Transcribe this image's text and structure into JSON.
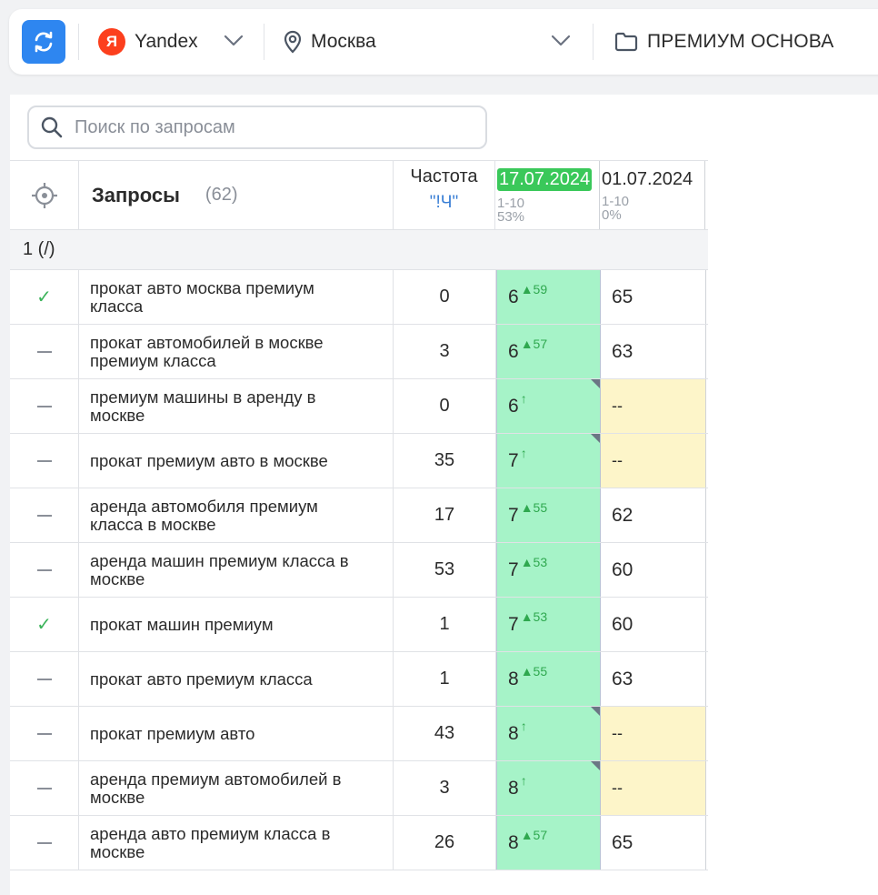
{
  "toolbar": {
    "engine": "Yandex",
    "engine_logo": "Я",
    "region": "Москва",
    "project": "ПРЕМИУМ ОСНОВА"
  },
  "search": {
    "placeholder": "Поиск по запросам",
    "value": ""
  },
  "table": {
    "queries_title": "Запросы",
    "queries_count": "(62)",
    "freq_title": "Частота",
    "freq_mode": "\"!Ч\"",
    "date1": {
      "date": "17.07.2024",
      "range": "1-10",
      "share": "53%"
    },
    "date2": {
      "date": "01.07.2024",
      "range": "1-10",
      "share": "0%"
    },
    "group_label": "1 (/)",
    "rows": [
      {
        "checked": true,
        "query": "прокат авто москва премиум класса",
        "freq": "0",
        "pos": "6",
        "delta": "▲59",
        "prev": "65",
        "corner": false
      },
      {
        "checked": false,
        "query": "прокат автомобилей в москве премиум класса",
        "freq": "3",
        "pos": "6",
        "delta": "▲57",
        "prev": "63",
        "corner": false
      },
      {
        "checked": false,
        "query": "премиум машины в аренду в москве",
        "freq": "0",
        "pos": "6",
        "delta": "↑",
        "prev": "--",
        "corner": true
      },
      {
        "checked": false,
        "query": "прокат премиум авто в москве",
        "freq": "35",
        "pos": "7",
        "delta": "↑",
        "prev": "--",
        "corner": true
      },
      {
        "checked": false,
        "query": "аренда автомобиля премиум класса в москве",
        "freq": "17",
        "pos": "7",
        "delta": "▲55",
        "prev": "62",
        "corner": false
      },
      {
        "checked": false,
        "query": "аренда машин премиум класса в москве",
        "freq": "53",
        "pos": "7",
        "delta": "▲53",
        "prev": "60",
        "corner": false
      },
      {
        "checked": true,
        "query": "прокат машин премиум",
        "freq": "1",
        "pos": "7",
        "delta": "▲53",
        "prev": "60",
        "corner": false
      },
      {
        "checked": false,
        "query": "прокат авто премиум класса",
        "freq": "1",
        "pos": "8",
        "delta": "▲55",
        "prev": "63",
        "corner": false
      },
      {
        "checked": false,
        "query": "прокат премиум авто",
        "freq": "43",
        "pos": "8",
        "delta": "↑",
        "prev": "--",
        "corner": true
      },
      {
        "checked": false,
        "query": "аренда премиум автомобилей в москве",
        "freq": "3",
        "pos": "8",
        "delta": "↑",
        "prev": "--",
        "corner": true
      },
      {
        "checked": false,
        "query": "аренда авто премиум класса в москве",
        "freq": "26",
        "pos": "8",
        "delta": "▲57",
        "prev": "65",
        "corner": false
      }
    ]
  },
  "colors": {
    "accent_blue": "#2e86f0",
    "top_position_green": "#a6f3c8",
    "date_badge_green": "#3ac85a",
    "no_data_yellow": "#fdf5c9",
    "delta_green": "#2fa84f"
  }
}
